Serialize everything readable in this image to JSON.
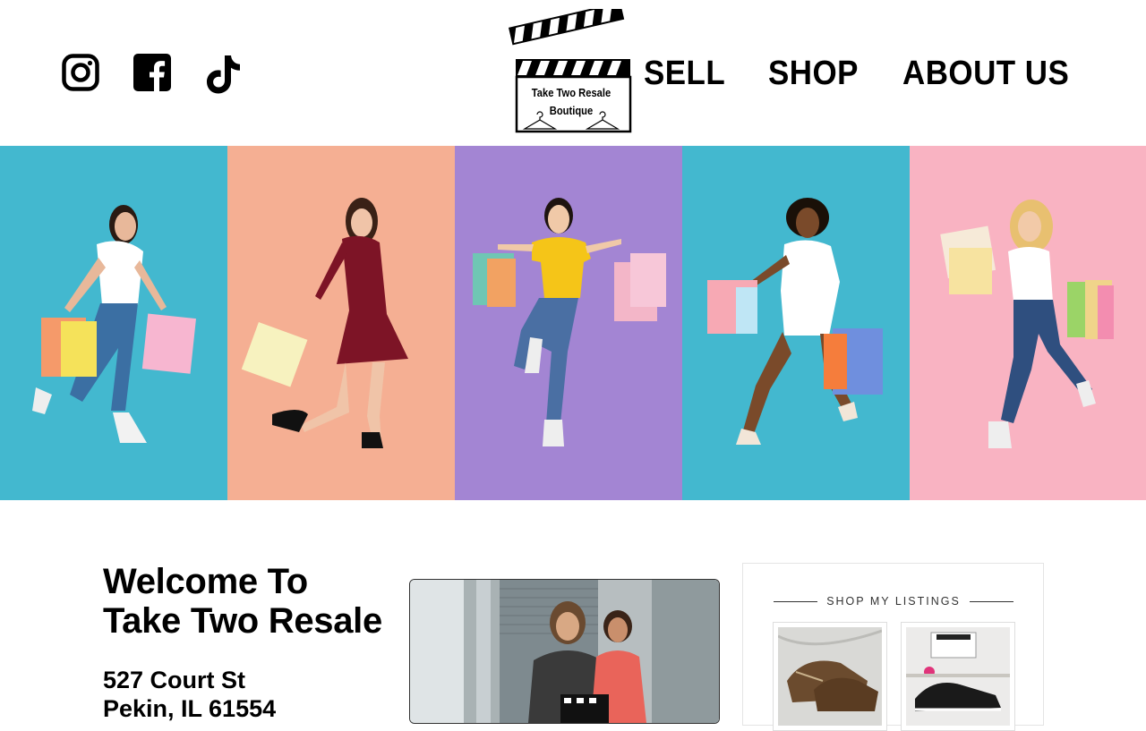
{
  "header": {
    "social": [
      {
        "name": "instagram",
        "icon": "instagram-icon"
      },
      {
        "name": "facebook",
        "icon": "facebook-icon"
      },
      {
        "name": "tiktok",
        "icon": "tiktok-icon"
      }
    ],
    "logo": {
      "line1": "Take Two Resale",
      "line2": "Boutique"
    },
    "nav": {
      "sell": "SELL",
      "shop": "SHOP",
      "about": "ABOUT US"
    }
  },
  "banner": {
    "panels": [
      {
        "bg": "#43b8cf",
        "top": "#ffffff",
        "bottom": "#3b6fa3",
        "hair": "#2a1a12",
        "skin": "#e8b89a"
      },
      {
        "bg": "#f5af93",
        "top": "#7d1426",
        "bottom": "#7d1426",
        "hair": "#3a2116",
        "skin": "#f0c4a8"
      },
      {
        "bg": "#a385d3",
        "top": "#f5c518",
        "bottom": "#4a6fa3",
        "hair": "#1e1410",
        "skin": "#f0c9a8"
      },
      {
        "bg": "#43b8cf",
        "top": "#ffffff",
        "bottom": "#ffffff",
        "hair": "#1a1008",
        "skin": "#7a4a2a"
      },
      {
        "bg": "#f9b3c2",
        "top": "#ffffff",
        "bottom": "#2f4f7f",
        "hair": "#e8c070",
        "skin": "#f2caa8"
      }
    ]
  },
  "welcome": {
    "title": "Welcome To Take Two Resale",
    "address_line1": "527 Court St",
    "address_line2": "Pekin, IL 61554"
  },
  "listings": {
    "header": "SHOP MY LISTINGS"
  },
  "colors": {
    "text": "#000000",
    "banner_teal": "#43b8cf",
    "banner_peach": "#f5af93",
    "banner_purple": "#a385d3",
    "banner_pink": "#f9b3c2"
  }
}
